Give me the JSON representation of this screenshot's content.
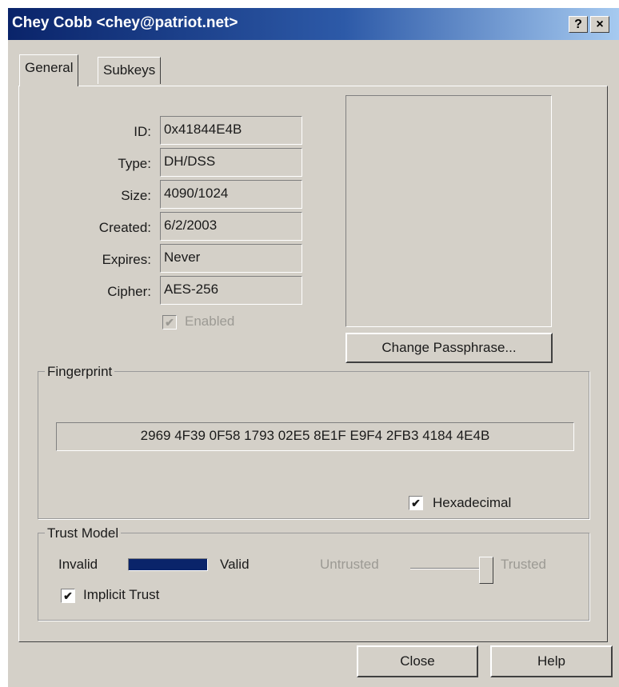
{
  "window": {
    "title": "Chey Cobb <chey@patriot.net>",
    "help_label": "?",
    "close_label": "×"
  },
  "tabs": [
    {
      "label": "General"
    },
    {
      "label": "Subkeys"
    }
  ],
  "key_info": {
    "fields": [
      {
        "label": "ID:",
        "value": "0x41844E4B"
      },
      {
        "label": "Type:",
        "value": "DH/DSS"
      },
      {
        "label": "Size:",
        "value": "4090/1024"
      },
      {
        "label": "Created:",
        "value": "6/2/2003"
      },
      {
        "label": "Expires:",
        "value": "Never"
      },
      {
        "label": "Cipher:",
        "value": "AES-256"
      }
    ],
    "enabled_label": "Enabled",
    "enabled_checked": true
  },
  "change_passphrase_label": "Change Passphrase...",
  "fingerprint": {
    "title": "Fingerprint",
    "value": "2969 4F39 0F58 1793 02E5  8E1F E9F4 2FB3 4184 4E4B",
    "hexadecimal_label": "Hexadecimal",
    "hexadecimal_checked": true
  },
  "trust_model": {
    "title": "Trust Model",
    "invalid_label": "Invalid",
    "valid_label": "Valid",
    "validity_fraction": 1.0,
    "validity_color": "#0a246a",
    "untrusted_label": "Untrusted",
    "trusted_label": "Trusted",
    "trust_fraction": 1.0,
    "implicit_trust_label": "Implicit Trust",
    "implicit_trust_checked": true
  },
  "footer": {
    "close_label": "Close",
    "help_label": "Help"
  },
  "checkmark_glyph": "✔"
}
